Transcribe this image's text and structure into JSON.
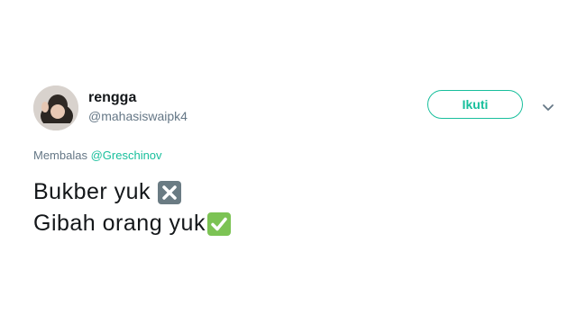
{
  "user": {
    "display_name": "rengga",
    "handle": "@mahasiswaipk4"
  },
  "follow_button": {
    "label": "Ikuti"
  },
  "reply": {
    "prefix": "Membalas",
    "mention": "@Greschinov"
  },
  "tweet": {
    "lines": [
      {
        "text": "Bukber yuk",
        "emoji": "cross-mark-icon"
      },
      {
        "text": "Gibah orang yuk",
        "emoji": "check-mark-icon"
      }
    ]
  },
  "colors": {
    "accent": "#18bf9c",
    "text": "#14171a",
    "muted": "#657786",
    "cross_bg": "#6a7b83",
    "check_bg": "#7cc354"
  }
}
